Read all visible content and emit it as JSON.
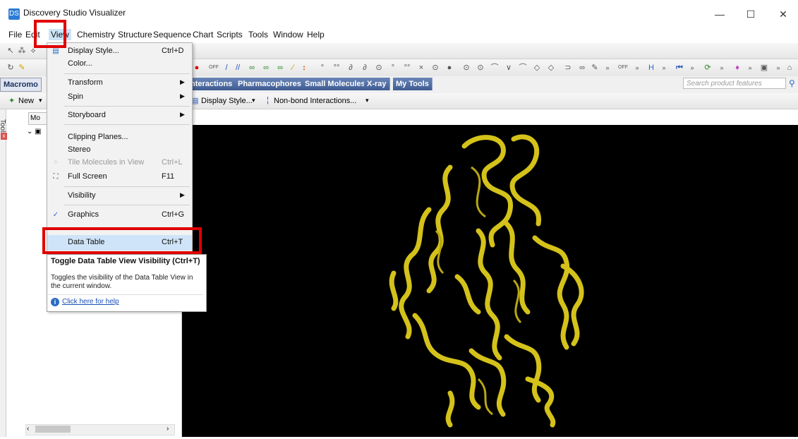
{
  "window": {
    "title": "Discovery Studio Visualizer",
    "app_icon_glyph": "DS",
    "controls": {
      "minimize": "—",
      "maximize": "☐",
      "close": "✕"
    }
  },
  "menubar": {
    "items": [
      "File",
      "Edit",
      "View",
      "Chemistry",
      "Structure",
      "Sequence",
      "Chart",
      "Scripts",
      "Tools",
      "Window",
      "Help"
    ]
  },
  "tabs": {
    "items": [
      "Macromo",
      "nteractions",
      "Pharmacophores",
      "Small Molecules",
      "X-ray",
      "My Tools"
    ],
    "search_placeholder": "Search product features"
  },
  "toolbar3": {
    "new_label": "New",
    "display_style_label": "Display Style...",
    "nonbond_label": "Non-bond Interactions..."
  },
  "left_panel": {
    "tools_label": "Tools",
    "tools_close": "x",
    "hierarchy_tab": "Mo"
  },
  "view_menu": {
    "items": [
      {
        "label": "Display Style...",
        "shortcut": "Ctrl+D",
        "icon": "display-style-icon"
      },
      {
        "label": "Color...",
        "shortcut": ""
      },
      {
        "label": "Transform",
        "submenu": true
      },
      {
        "label": "Spin",
        "submenu": true
      },
      {
        "label": "Storyboard",
        "submenu": true
      },
      {
        "label": "Clipping Planes...",
        "shortcut": ""
      },
      {
        "label": "Stereo",
        "shortcut": ""
      },
      {
        "label": "Tile Molecules in View",
        "shortcut": "Ctrl+L",
        "disabled": true
      },
      {
        "label": "Full Screen",
        "shortcut": "F11",
        "icon": "fullscreen-icon"
      },
      {
        "label": "Visibility",
        "submenu": true
      },
      {
        "label": "Graphics",
        "shortcut": "Ctrl+G",
        "checked": true
      },
      {
        "label": "Data Table",
        "shortcut": "Ctrl+T",
        "highlighted": true
      }
    ]
  },
  "tooltip": {
    "title": "Toggle Data Table View Visibility (Ctrl+T)",
    "body": "Toggles the visibility of the Data Table View in the current window.",
    "help_link": "Click here for help",
    "help_icon_glyph": "i"
  },
  "viewer": {
    "background": "#000000",
    "ribbon_color": "#d4c21a"
  },
  "accent": {
    "highlight_box": "#e00000",
    "menu_hover": "#cfe4f8"
  }
}
